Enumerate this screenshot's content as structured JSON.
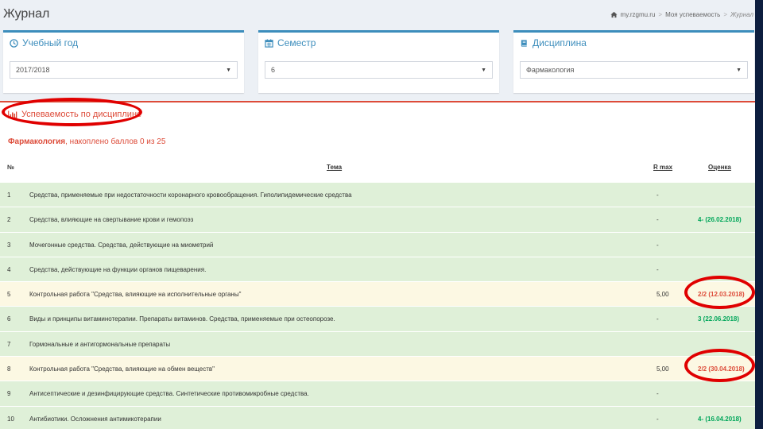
{
  "header": {
    "title": "Журнал",
    "breadcrumb": [
      "my.rzgmu.ru",
      "Моя успеваемость",
      "Журнал"
    ]
  },
  "filters": {
    "year": {
      "label": "Учебный год",
      "value": "2017/2018"
    },
    "semester": {
      "label": "Семестр",
      "value": "6"
    },
    "discipline": {
      "label": "Дисциплина",
      "value": "Фармакология"
    }
  },
  "performance": {
    "title": "Успеваемость по дисциплине",
    "discipline_name": "Фармакология",
    "summary": ", накоплено баллов 0 из 25"
  },
  "table": {
    "headers": {
      "num": "№",
      "topic": "Тема",
      "r": "R max",
      "grade": "Оценка"
    },
    "rows": [
      {
        "num": "1",
        "topic": "Средства, применяемые при недостаточности коронарного кровообращения. Гиполипидемические средства",
        "r": "-",
        "grade": "",
        "status": "green"
      },
      {
        "num": "2",
        "topic": "Средства, влияющие на свертывание крови и гемопоэз",
        "r": "-",
        "grade": "4- (26.02.2018)",
        "status": "green"
      },
      {
        "num": "3",
        "topic": "Мочегонные средства. Средства, действующие на миометрий",
        "r": "-",
        "grade": "",
        "status": "green"
      },
      {
        "num": "4",
        "topic": "Средства, действующие на функции органов пищеварения.",
        "r": "-",
        "grade": "",
        "status": "green"
      },
      {
        "num": "5",
        "topic": "Контрольная работа \"Средства, влияющие на исполнительные органы\"",
        "r": "5,00",
        "grade": "2/2 (12.03.2018)",
        "status": "yellow"
      },
      {
        "num": "6",
        "topic": "Виды и принципы витаминотерапии. Препараты витаминов. Средства, применяемые при остеопорозе.",
        "r": "-",
        "grade": "3 (22.06.2018)",
        "status": "green"
      },
      {
        "num": "7",
        "topic": "Гормональные и антигормональные препараты",
        "r": "",
        "grade": "",
        "status": "green"
      },
      {
        "num": "8",
        "topic": "Контрольная работа \"Средства, влияющие на обмен веществ\"",
        "r": "5,00",
        "grade": "2/2 (30.04.2018)",
        "status": "yellow"
      },
      {
        "num": "9",
        "topic": "Антисептические и дезинфицирующие средства. Синтетические противомикробные средства.",
        "r": "-",
        "grade": "",
        "status": "green"
      },
      {
        "num": "10",
        "topic": "Антибиотики. Осложнения антимикотерапии",
        "r": "-",
        "grade": "4- (16.04.2018)",
        "status": "green"
      }
    ]
  },
  "colors": {
    "primary": "#3c8dbc",
    "danger": "#dd4b39",
    "success": "#00a65a",
    "row_green": "#dff0d8",
    "row_yellow": "#fcf8e3",
    "highlight": "#e00000"
  },
  "icons": {
    "home": "home-icon",
    "year": "clock-icon",
    "semester": "calendar-icon",
    "discipline": "book-icon",
    "performance": "bar-chart-icon",
    "select": "caret-down-icon"
  }
}
